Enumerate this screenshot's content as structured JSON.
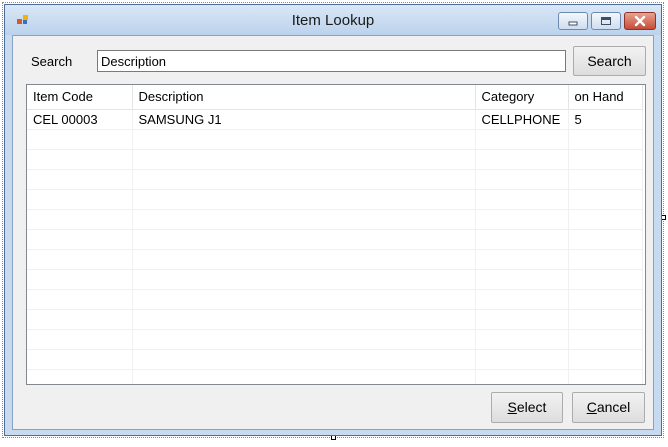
{
  "window": {
    "title": "Item Lookup",
    "controls": [
      "minimize-icon",
      "maximize-icon",
      "close-icon"
    ]
  },
  "search": {
    "label": "Search",
    "value": "Description",
    "button_label": "Search"
  },
  "grid": {
    "columns": [
      "Item Code",
      "Description",
      "Category",
      "on Hand"
    ],
    "rows": [
      [
        "CEL 00003",
        "SAMSUNG J1",
        "CELLPHONE",
        "5"
      ],
      [
        "",
        "",
        "",
        ""
      ],
      [
        "",
        "",
        "",
        ""
      ],
      [
        "",
        "",
        "",
        ""
      ],
      [
        "",
        "",
        "",
        ""
      ],
      [
        "",
        "",
        "",
        ""
      ],
      [
        "",
        "",
        "",
        ""
      ],
      [
        "",
        "",
        "",
        ""
      ],
      [
        "",
        "",
        "",
        ""
      ],
      [
        "",
        "",
        "",
        ""
      ],
      [
        "",
        "",
        "",
        ""
      ],
      [
        "",
        "",
        "",
        ""
      ],
      [
        "",
        "",
        "",
        ""
      ],
      [
        "",
        "",
        "",
        ""
      ]
    ]
  },
  "footer": {
    "select_label": "Select",
    "cancel_label": "Cancel"
  },
  "colors": {
    "title_bar": "#bcd2ec",
    "close_button": "#c44d37",
    "dialog_background": "#f0f0f0"
  }
}
